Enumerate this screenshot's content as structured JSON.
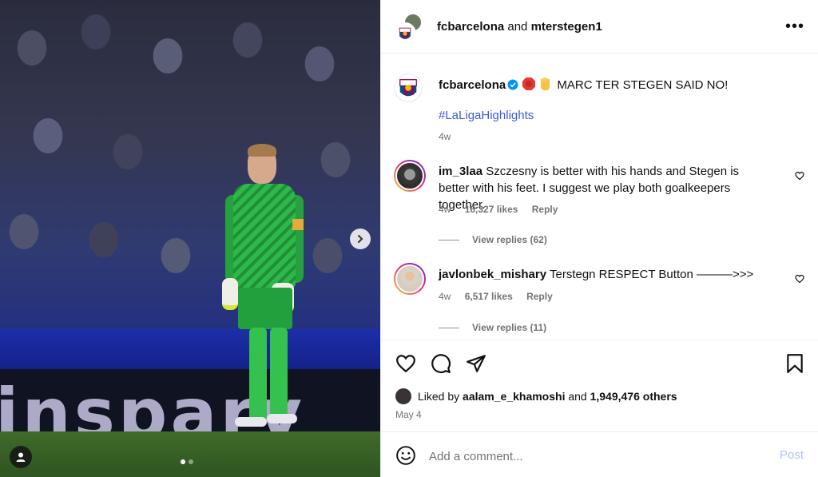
{
  "header": {
    "user1": "fcbarcelona",
    "conjunction": "and",
    "user2": "mterstegen1",
    "more": "•••"
  },
  "caption": {
    "username": "fcbarcelona",
    "text": "MARC TER STEGEN SAID NO!",
    "hashtag": "#LaLigaHighlights",
    "time": "4w",
    "emojis": [
      "stop-sign-icon",
      "raised-hand-icon"
    ]
  },
  "comments": [
    {
      "username": "im_3laa",
      "text": "Szczesny is better with his hands and Stegen is better with his feet. I suggest we play both goalkeepers together.",
      "time": "4w",
      "likes": "16,327 likes",
      "reply": "Reply",
      "view_replies": "View replies (62)"
    },
    {
      "username": "javlonbek_mishary",
      "text": "Terstegn RESPECT Button ———>>>",
      "time": "4w",
      "likes": "6,517 likes",
      "reply": "Reply",
      "view_replies": "View replies (11)"
    }
  ],
  "likes": {
    "prefix": "Liked by",
    "user": "aalam_e_khamoshi",
    "middle": "and",
    "others": "1,949,476 others"
  },
  "post_date": "May 4",
  "add_comment": {
    "placeholder": "Add a comment...",
    "post_label": "Post"
  },
  "media": {
    "ad_text": "insparv",
    "carousel_count": 2,
    "carousel_active": 0
  },
  "colors": {
    "link": "#3b5bdb",
    "muted": "#737373",
    "post_disabled": "#b3c4f5",
    "verified": "#0095f6"
  }
}
